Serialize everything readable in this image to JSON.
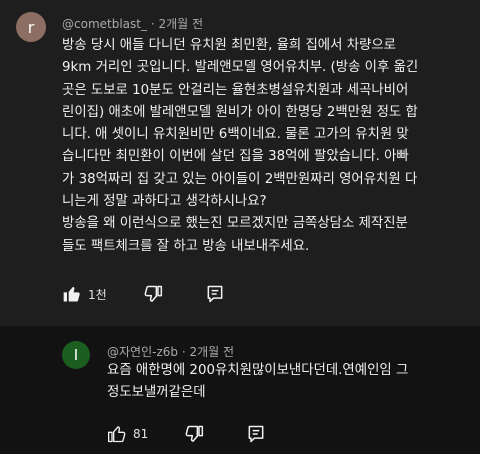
{
  "comments": [
    {
      "avatar_letter": "r",
      "author": "@cometblast_",
      "time": "2개월 전",
      "text": [
        "방송 당시 애들 다니던 유치원 최민환, 율희 집에서 차량으로",
        "9km 거리인 곳입니다. 발레앤모델 영어유치부. (방송 이후 옮긴",
        "곳은 도보로 10분도 안걸리는 율현초병설유치원과 세곡나비어",
        "린이집) 애초에 발레앤모델 원비가 아이 한명당 2백만원 정도 합",
        "니다. 애 셋이니 유치원비만 6백이네요. 물론 고가의 유치원 맞",
        "습니다만 최민환이 이번에 살던 집을 38억에 팔았습니다. 아빠",
        "가 38억짜리 집 갖고 있는 아이들이 2백만원짜리 영어유치원 다",
        "니는게 정말 과하다고 생각하시나요?",
        "방송을 왜 이런식으로 했는진 모르겠지만 금쪽상담소 제작진분",
        "들도 팩트체크를 잘 하고 방송 내보내주세요."
      ],
      "likes": "1천"
    },
    {
      "avatar_letter": "I",
      "author": "@자연인-z6b",
      "time": "2개월 전",
      "text": [
        "요즘 애한명에 200유치원많이보낸다던데.연예인임 그",
        "정도보낼꺼같은데"
      ],
      "likes": "81"
    }
  ],
  "icons": [
    "thumbs-up-icon",
    "thumbs-down-icon",
    "reply-icon"
  ]
}
